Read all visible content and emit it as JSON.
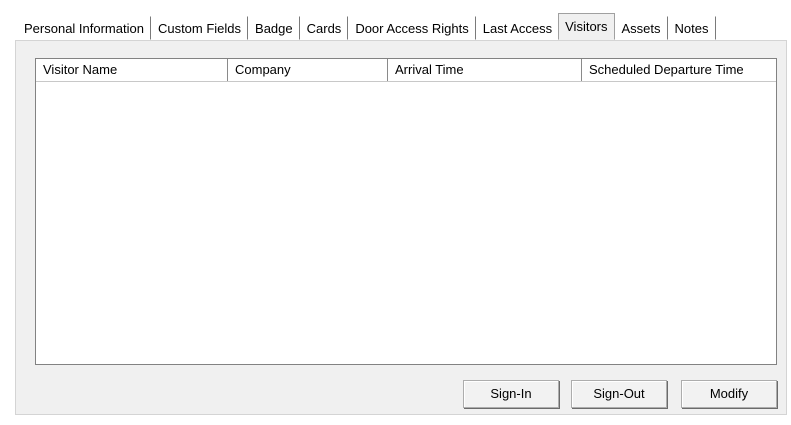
{
  "tabs": [
    {
      "label": "Personal Information",
      "active": false
    },
    {
      "label": "Custom Fields",
      "active": false
    },
    {
      "label": "Badge",
      "active": false
    },
    {
      "label": "Cards",
      "active": false
    },
    {
      "label": "Door Access Rights",
      "active": false
    },
    {
      "label": "Last Access",
      "active": false
    },
    {
      "label": "Visitors",
      "active": true
    },
    {
      "label": "Assets",
      "active": false
    },
    {
      "label": "Notes",
      "active": false
    }
  ],
  "visitors_list": {
    "columns": [
      "Visitor Name",
      "Company",
      "Arrival Time",
      "Scheduled Departure Time"
    ],
    "rows": []
  },
  "buttons": {
    "sign_in": "Sign-In",
    "sign_out": "Sign-Out",
    "modify": "Modify"
  }
}
